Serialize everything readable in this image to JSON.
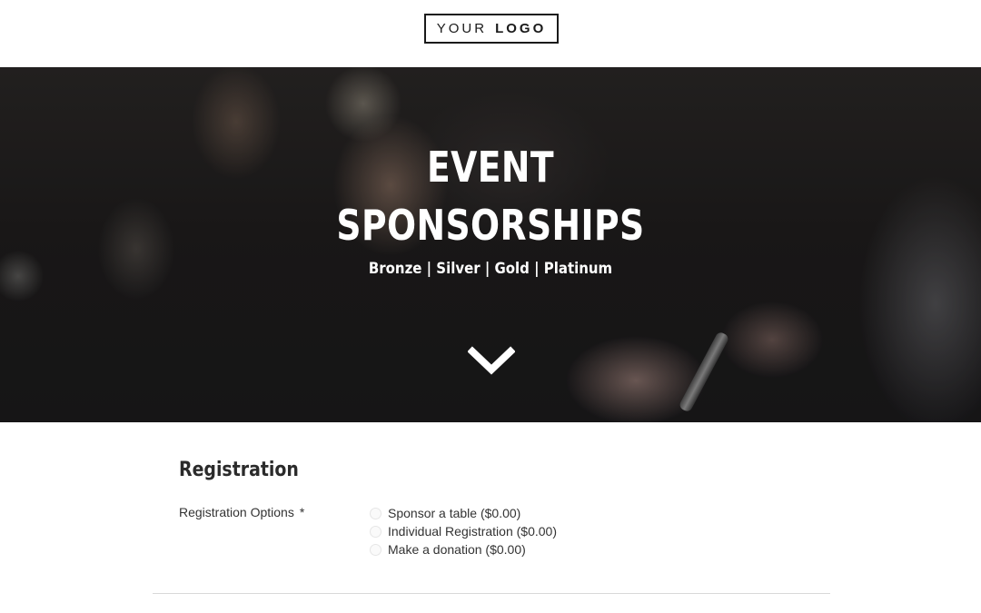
{
  "header": {
    "logo_word_1": "YOUR",
    "logo_word_2": "LOGO"
  },
  "hero": {
    "title_line_1": "EVENT",
    "title_line_2": "SPONSORSHIPS",
    "subtitle": "Bronze | Silver | Gold | Platinum",
    "scroll_icon": "chevron-down-icon"
  },
  "form": {
    "section_title": "Registration",
    "field_label": "Registration Options",
    "required_marker": "*",
    "options": [
      {
        "label": "Sponsor a table ($0.00)",
        "selected": false
      },
      {
        "label": "Individual Registration ($0.00)",
        "selected": false
      },
      {
        "label": "Make a donation ($0.00)",
        "selected": false
      }
    ]
  },
  "colors": {
    "text": "#2b2b2b",
    "hero_text": "#ffffff",
    "divider": "#d9d9d9"
  }
}
